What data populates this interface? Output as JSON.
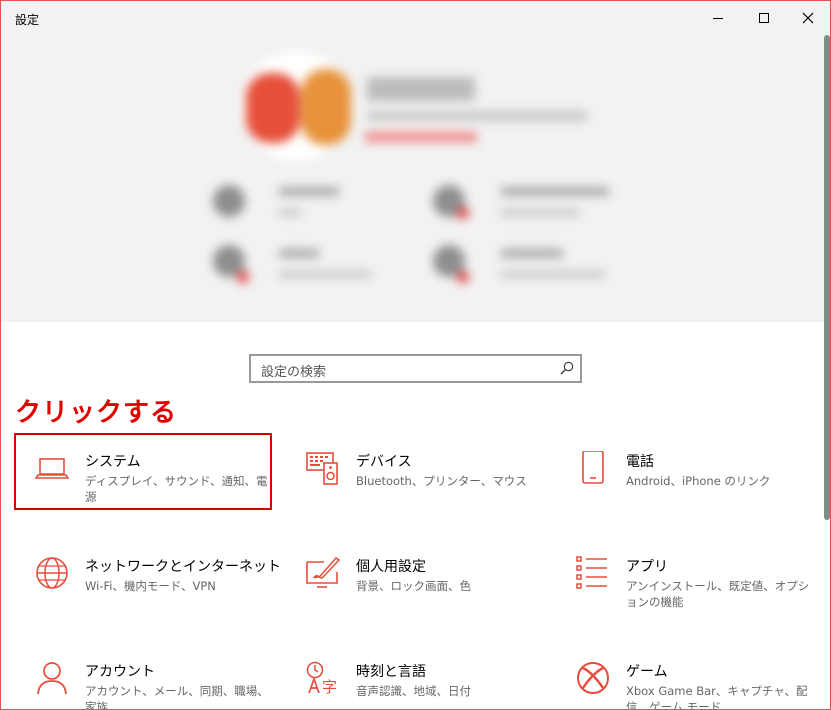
{
  "window": {
    "title": "設定",
    "minimize": "—",
    "maximize": "☐",
    "close": "✕"
  },
  "search": {
    "placeholder": "設定の検索"
  },
  "annotation": {
    "text": "クリックする",
    "color": "#e00000"
  },
  "accent_color": "#e74c3c",
  "categories": [
    {
      "name": "システム",
      "desc": "ディスプレイ、サウンド、通知、電源",
      "icon": "laptop-icon"
    },
    {
      "name": "デバイス",
      "desc": "Bluetooth、プリンター、マウス",
      "icon": "keyboard-speaker-icon"
    },
    {
      "name": "電話",
      "desc": "Android、iPhone のリンク",
      "icon": "phone-icon"
    },
    {
      "name": "ネットワークとインターネット",
      "desc": "Wi-Fi、機内モード、VPN",
      "icon": "globe-icon"
    },
    {
      "name": "個人用設定",
      "desc": "背景、ロック画面、色",
      "icon": "paint-tablet-icon"
    },
    {
      "name": "アプリ",
      "desc": "アンインストール、既定値、オプションの機能",
      "icon": "apps-list-icon"
    },
    {
      "name": "アカウント",
      "desc": "アカウント、メール、同期、職場、家族",
      "icon": "person-icon"
    },
    {
      "name": "時刻と言語",
      "desc": "音声認識、地域、日付",
      "icon": "time-language-icon"
    },
    {
      "name": "ゲーム",
      "desc": "Xbox Game Bar、キャプチャ、配信、ゲーム モード",
      "icon": "xbox-icon"
    }
  ]
}
